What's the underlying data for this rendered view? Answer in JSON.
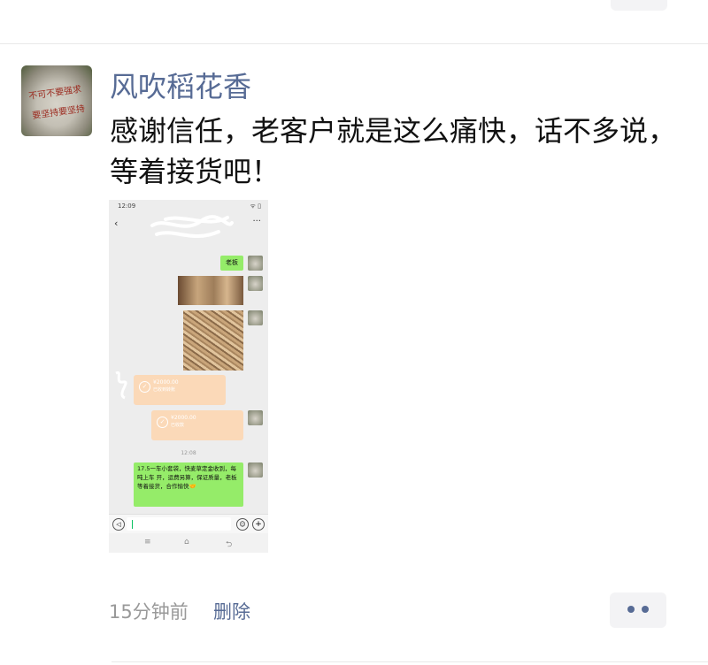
{
  "post": {
    "nickname": "风吹稻花香",
    "text": "感谢信任，老客户就是这么痛快，话不多说，等着接货吧！",
    "time": "15分钟前",
    "delete_label": "删除",
    "avatar_text": [
      "不可不要强求",
      "要坚持要坚持"
    ]
  },
  "screenshot": {
    "status_time": "12:09",
    "status_icons": "ᯤ ▯",
    "bubble_boss": "老板",
    "transfer1_amount": "¥2000.00",
    "transfer1_sub": "已收到转账",
    "transfer2_amount": "¥2000.00",
    "transfer2_sub": "已收款",
    "chat_time": "12:08",
    "message": "17.5一车小套袋，快麦草定金收到，每吨上车 开，运费另算，保证质量，老板等着接货，合作愉快🤝",
    "nav_icons": [
      "≡",
      "⌂",
      "⮌"
    ]
  },
  "colors": {
    "link": "#576b95",
    "wechat_green": "#95ec69",
    "transfer_orange": "#fbd9b8"
  },
  "icons": [
    "back-arrow-icon",
    "more-dots-icon",
    "voice-icon",
    "emoji-icon",
    "add-icon",
    "check-circle-icon"
  ]
}
